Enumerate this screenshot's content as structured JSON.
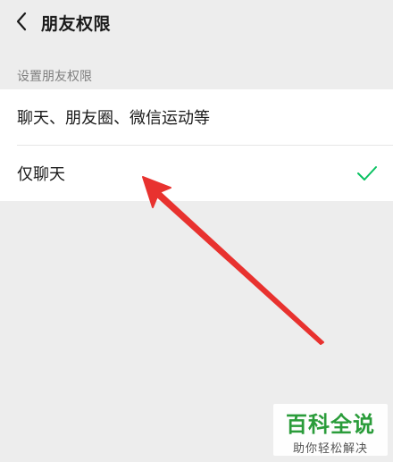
{
  "header": {
    "back_icon": "chevron-left-icon",
    "title": "朋友权限"
  },
  "section": {
    "label": "设置朋友权限"
  },
  "options": [
    {
      "label": "聊天、朋友圈、微信运动等",
      "selected": false
    },
    {
      "label": "仅聊天",
      "selected": true
    }
  ],
  "colors": {
    "background": "#ededed",
    "check": "#07c160",
    "arrow": "#e8322f",
    "watermark": "#2a9c3a"
  },
  "watermark": {
    "logo": "百科全说",
    "subtitle": "助你轻松解决"
  }
}
